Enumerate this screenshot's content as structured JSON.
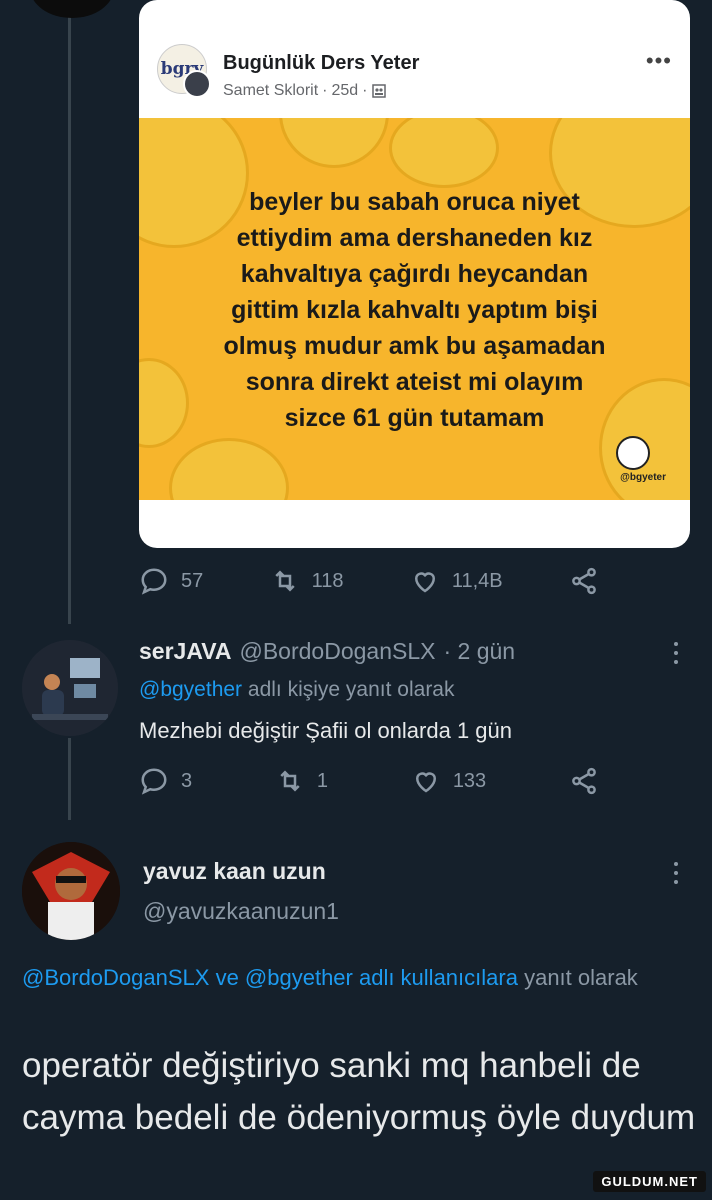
{
  "quoted_post": {
    "page_name": "Bugünlük Ders Yeter",
    "logo_text": "bgry",
    "author": "Samet Sklorit",
    "time": "25d",
    "meme_text_lines": [
      "beyler bu sabah oruca niyet",
      "ettiydim ama dershaneden kız",
      "kahvaltıya çağırdı heycandan",
      "gittim kızla kahvaltı yaptım bişi",
      "olmuş mudur amk bu aşamadan",
      "sonra direkt ateist mi olayım",
      "sizce 61 gün tutamam"
    ],
    "meme_handle": "@bgyeter"
  },
  "tweet_actions": {
    "replies": "57",
    "retweets": "118",
    "likes": "11,4B"
  },
  "reply": {
    "name": "serJAVA",
    "handle": "@BordoDoganSLX",
    "time": "· 2 gün",
    "reply_to_handle": "@bgyether",
    "reply_to_suffix": "adlı kişiye yanıt olarak",
    "text": "Mezhebi değiştir Şafii ol onlarda 1 gün",
    "actions": {
      "replies": "3",
      "retweets": "1",
      "likes": "133"
    }
  },
  "main_tweet": {
    "name": "yavuz kaan uzun",
    "handle": "@yavuzkaanuzun1",
    "reply_to_links": "@BordoDoganSLX ve @bgyether adlı kullanıcılara",
    "reply_to_suffix": "yanıt olarak",
    "text": "operatör değiştiriyo sanki mq hanbeli de cayma bedeli de ödeniyormuş öyle duydum"
  },
  "watermark": "GULDUM.NET",
  "colors": {
    "background": "#15202b",
    "link": "#1d9bf0",
    "muted": "#8b98a5",
    "meme_yellow": "#f7b52c"
  }
}
